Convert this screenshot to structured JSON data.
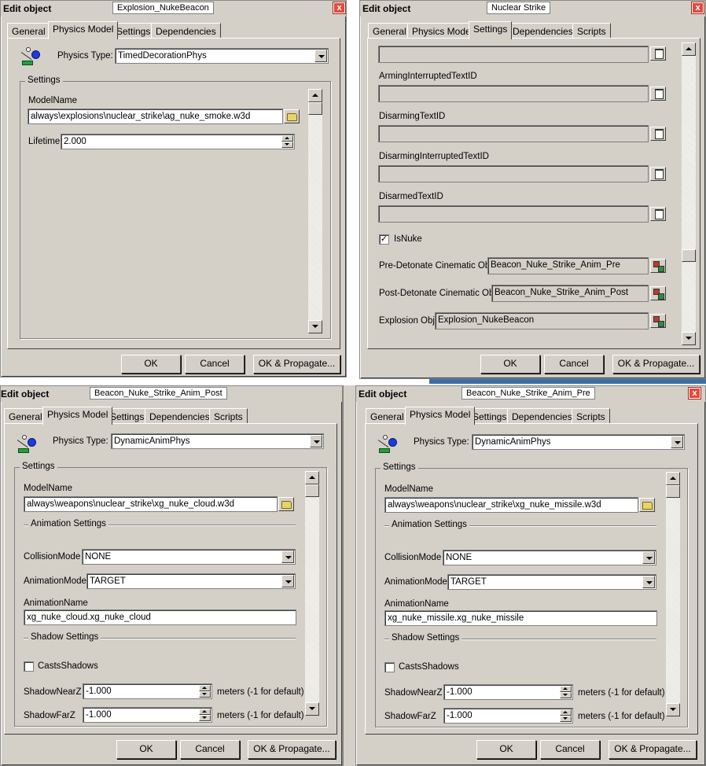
{
  "common": {
    "app_title": "Edit object",
    "close_glyph": "x",
    "ok_label": "OK",
    "cancel_label": "Cancel",
    "ok_propagate_label": "OK & Propagate...",
    "settings_group_label": "Settings",
    "physics_type_label": "Physics Type:",
    "model_name_label": "ModelName"
  },
  "dialog1": {
    "object_name": "Explosion_NukeBeacon",
    "tabs": [
      "General",
      "Physics Model",
      "Settings",
      "Dependencies"
    ],
    "active_tab": "Physics Model",
    "physics_type": "TimedDecorationPhys",
    "model_name": "always\\explosions\\nuclear_strike\\ag_nuke_smoke.w3d",
    "lifetime_label": "Lifetime",
    "lifetime_value": "2.000"
  },
  "dialog2": {
    "object_name": "Nuclear Strike",
    "tabs": [
      "General",
      "Physics Model",
      "Settings",
      "Dependencies",
      "Scripts"
    ],
    "active_tab": "Settings",
    "text_fields": [
      {
        "label": "",
        "value": ""
      },
      {
        "label": "ArmingInterruptedTextID",
        "value": ""
      },
      {
        "label": "DisarmingTextID",
        "value": ""
      },
      {
        "label": "DisarmingInterruptedTextID",
        "value": ""
      },
      {
        "label": "DisarmedTextID",
        "value": ""
      }
    ],
    "is_nuke_label": "IsNuke",
    "is_nuke_checked": true,
    "check_glyph": "✓",
    "pre_detonate_label": "Pre-Detonate Cinematic Obj",
    "pre_detonate_value": "Beacon_Nuke_Strike_Anim_Pre",
    "post_detonate_label": "Post-Detonate Cinematic Obj",
    "post_detonate_value": "Beacon_Nuke_Strike_Anim_Post",
    "explosion_label": "Explosion Obj",
    "explosion_value": "Explosion_NukeBeacon"
  },
  "dialog3": {
    "object_name": "Beacon_Nuke_Strike_Anim_Post",
    "tabs": [
      "General",
      "Physics Model",
      "Settings",
      "Dependencies",
      "Scripts"
    ],
    "active_tab": "Physics Model",
    "physics_type": "DynamicAnimPhys",
    "model_name": "always\\weapons\\nuclear_strike\\xg_nuke_cloud.w3d",
    "animation_settings_label": "Animation Settings",
    "collision_mode_label": "CollisionMode",
    "collision_mode": "NONE",
    "animation_mode_label": "AnimationMode",
    "animation_mode": "TARGET",
    "animation_name_label": "AnimationName",
    "animation_name": "xg_nuke_cloud.xg_nuke_cloud",
    "shadow_settings_label": "Shadow Settings",
    "casts_shadows_label": "CastsShadows",
    "shadow_near_label": "ShadowNearZ",
    "shadow_near_value": "-1.000",
    "shadow_near_hint": "meters (-1 for default)",
    "shadow_far_label": "ShadowFarZ",
    "shadow_far_value": "-1.000",
    "shadow_far_hint": "meters (-1 for default)"
  },
  "dialog4": {
    "object_name": "Beacon_Nuke_Strike_Anim_Pre",
    "tabs": [
      "General",
      "Physics Model",
      "Settings",
      "Dependencies",
      "Scripts"
    ],
    "active_tab": "Physics Model",
    "physics_type": "DynamicAnimPhys",
    "model_name": "always\\weapons\\nuclear_strike\\xg_nuke_missile.w3d",
    "animation_settings_label": "Animation Settings",
    "collision_mode_label": "CollisionMode",
    "collision_mode": "NONE",
    "animation_mode_label": "AnimationMode",
    "animation_mode": "TARGET",
    "animation_name_label": "AnimationName",
    "animation_name": "xg_nuke_missile.xg_nuke_missile",
    "shadow_settings_label": "Shadow Settings",
    "casts_shadows_label": "CastsShadows",
    "shadow_near_label": "ShadowNearZ",
    "shadow_near_value": "-1.000",
    "shadow_near_hint": "meters (-1 for default)",
    "shadow_far_label": "ShadowFarZ",
    "shadow_far_value": "-1.000",
    "shadow_far_hint": "meters (-1 for default)"
  }
}
